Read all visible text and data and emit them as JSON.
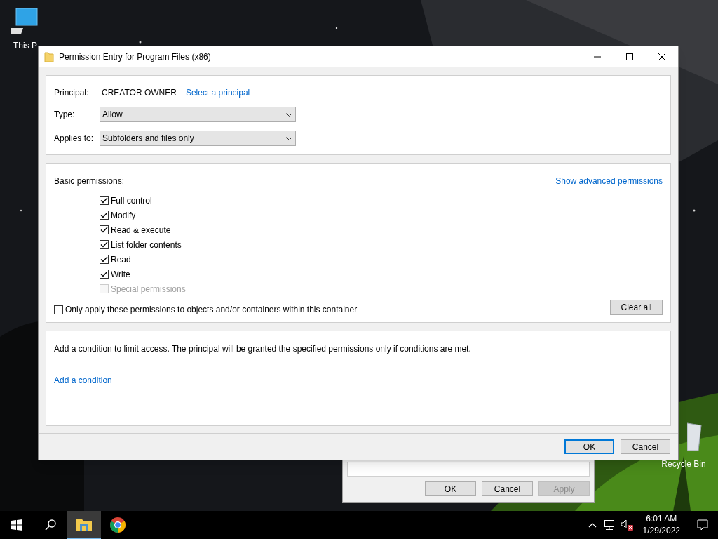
{
  "desktop_icons": [
    {
      "kind": "pc",
      "label": "This P"
    },
    {
      "kind": "bin",
      "label": "Recycle Bin"
    }
  ],
  "dialog": {
    "title": "Permission Entry for Program Files (x86)",
    "principal": {
      "label": "Principal:",
      "value": "CREATOR OWNER",
      "link": "Select a principal"
    },
    "type": {
      "label": "Type:",
      "value": "Allow"
    },
    "applies_to": {
      "label": "Applies to:",
      "value": "Subfolders and files only"
    },
    "basic_permissions": {
      "label": "Basic permissions:",
      "link": "Show advanced permissions",
      "items": [
        {
          "label": "Full control",
          "checked": true,
          "disabled": false
        },
        {
          "label": "Modify",
          "checked": true,
          "disabled": false
        },
        {
          "label": "Read & execute",
          "checked": true,
          "disabled": false
        },
        {
          "label": "List folder contents",
          "checked": true,
          "disabled": false
        },
        {
          "label": "Read",
          "checked": true,
          "disabled": false
        },
        {
          "label": "Write",
          "checked": true,
          "disabled": false
        },
        {
          "label": "Special permissions",
          "checked": false,
          "disabled": true
        }
      ]
    },
    "only_apply": {
      "label": "Only apply these permissions to objects and/or containers within this container",
      "checked": false
    },
    "clear_all": "Clear all",
    "condition": {
      "text": "Add a condition to limit access. The principal will be granted the specified permissions only if conditions are met.",
      "link": "Add a condition"
    },
    "buttons": [
      {
        "label": "OK",
        "default": true
      },
      {
        "label": "Cancel",
        "default": false
      }
    ]
  },
  "background_window": {
    "buttons": [
      {
        "label": "OK",
        "disabled": false
      },
      {
        "label": "Cancel",
        "disabled": false
      },
      {
        "label": "Apply",
        "disabled": true
      }
    ]
  },
  "taskbar": {
    "apps": [
      {
        "kind": "explorer",
        "active": true
      },
      {
        "kind": "chrome",
        "active": false
      }
    ],
    "time": "6:01 AM",
    "date": "1/29/2022"
  }
}
